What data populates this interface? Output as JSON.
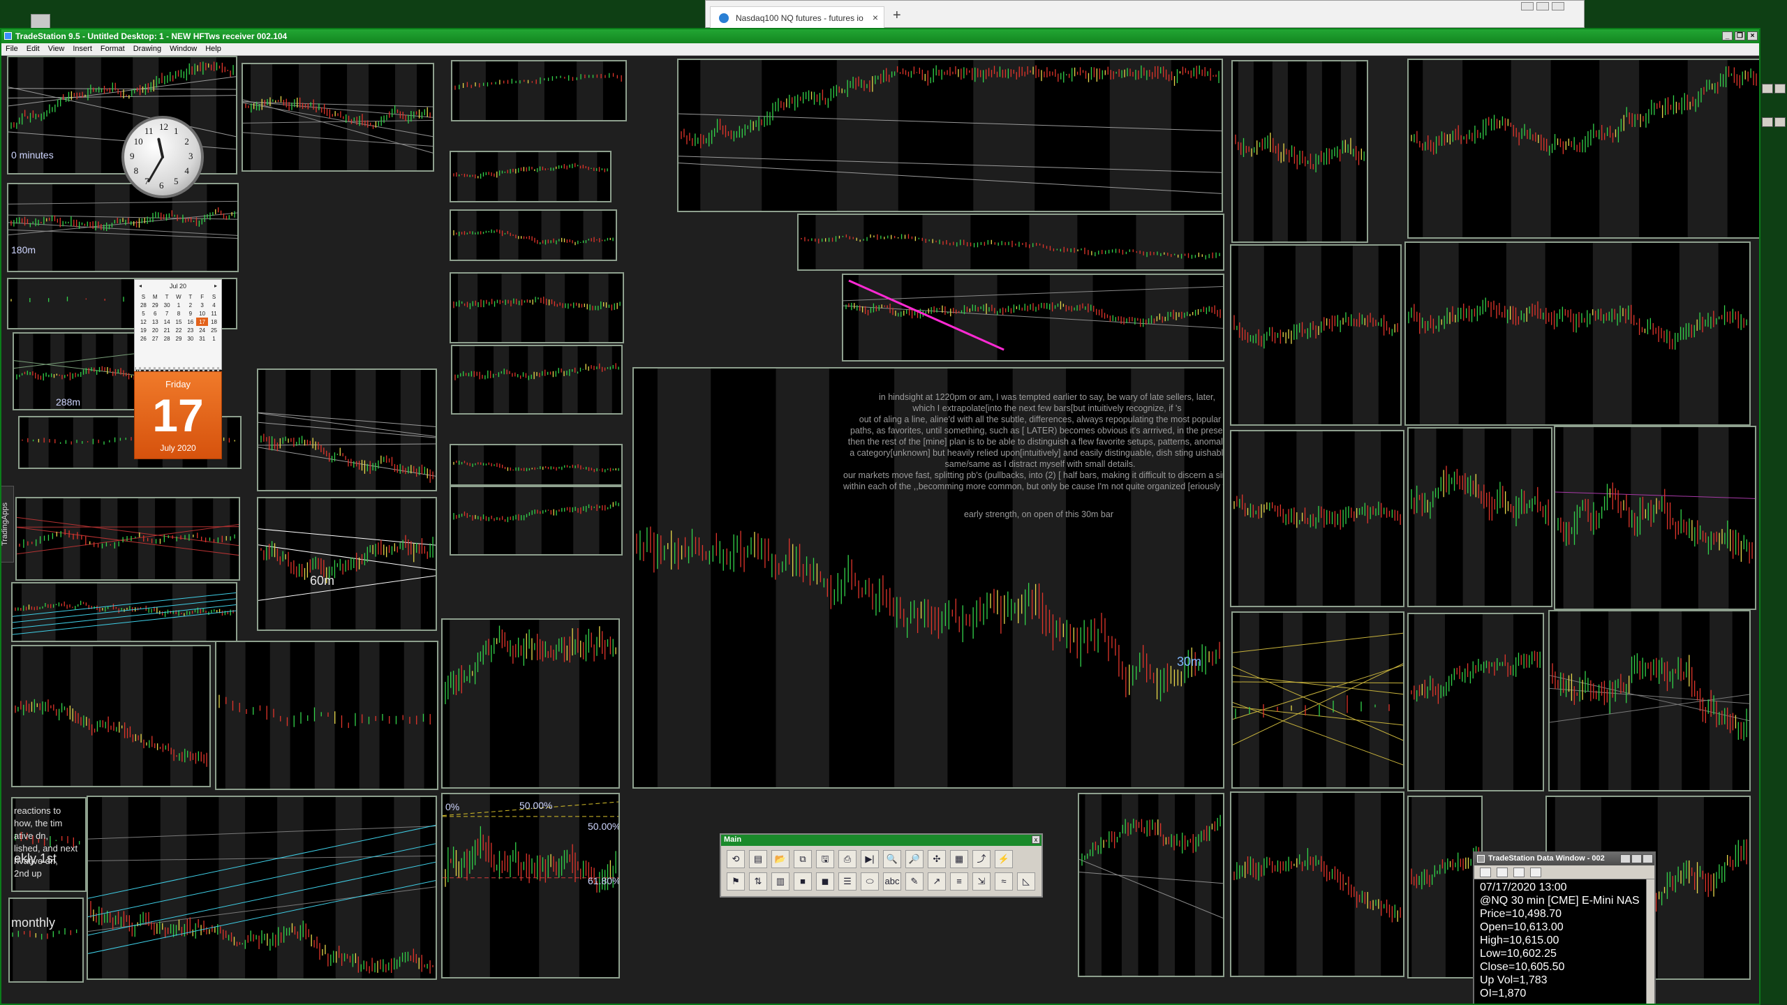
{
  "browser": {
    "tab_title": "Nasdaq100 NQ futures - futures io",
    "close_glyph": "×",
    "new_tab_glyph": "+"
  },
  "window": {
    "title": "TradeStation 9.5 - Untitled Desktop: 1 - NEW HFTws receiver 002.104",
    "menu": [
      "File",
      "Edit",
      "View",
      "Insert",
      "Format",
      "Drawing",
      "Window",
      "Help"
    ]
  },
  "side_tab": "TradingApps",
  "clock": {
    "numerals": [
      "12",
      "1",
      "2",
      "3",
      "4",
      "5",
      "6",
      "7",
      "8",
      "9",
      "10",
      "11"
    ],
    "hour": 11,
    "minute": 35
  },
  "calendar": {
    "month_label": "Jul 20",
    "prev": "◂",
    "next": "▸",
    "weekdays": [
      "S",
      "M",
      "T",
      "W",
      "T",
      "F",
      "S"
    ],
    "weeks": [
      [
        "28",
        "29",
        "30",
        "1",
        "2",
        "3",
        "4"
      ],
      [
        "5",
        "6",
        "7",
        "8",
        "9",
        "10",
        "11"
      ],
      [
        "12",
        "13",
        "14",
        "15",
        "16",
        "17",
        "18"
      ],
      [
        "19",
        "20",
        "21",
        "22",
        "23",
        "24",
        "25"
      ],
      [
        "26",
        "27",
        "28",
        "29",
        "30",
        "31",
        "1"
      ]
    ],
    "today": "17",
    "day_name": "Friday",
    "day_number": "17",
    "month_year": "July 2020"
  },
  "chart_labels": {
    "tl_minutes": "0 minutes",
    "c180": "180m",
    "c288": "288m",
    "c60": "60m",
    "c30": "30m",
    "monthly": "monthly",
    "weekly": "ekly 1st",
    "pct0": "0%",
    "pct50a": "50.00%",
    "pct50b": "50.00%",
    "pct61": "61.80%",
    "weekly_notes": [
      "reactions to",
      "how, the tim",
      "ative dn,",
      "lished, and next",
      "rivative dn,",
      "2nd up"
    ]
  },
  "annotations": [
    "in hindsight at 1220pm or am, I was tempted earlier to say, be wary of late sellers, later,",
    "which I extrapolate[into the next few bars[but intuitively recognize, if 's",
    "out of aling a line, aline'd with all the subtle, differences, always repopulating the most popular",
    "paths, as favorites, until something, such as [ LATER) becomes obvious it's arrrived, in the present",
    "then the rest of the [mine] plan is to be able to distinguish a flew favorite setups, patterns, anomalies, of",
    "a category[unknown] but heavily relied upon[intuitively] and easily distinguable, dish sting uishable,",
    "same/same as I distract myself with small details.",
    "our markets move fast, splitting pb's (pullbacks, into (2) [ half bars, making it difficult to discern a single pricebar",
    "within each of the ,,becomming more common, but only be cause I'm not quite organized [eriously funny, but tru",
    "early strength, on open of this 30m bar"
  ],
  "main_toolbar": {
    "title": "Main",
    "close": "x",
    "buttons": [
      "⟲",
      "▤",
      "📂",
      "⧉",
      "🖫",
      "⎙",
      "▶|",
      "🔍",
      "🔎",
      "✣",
      "▦",
      "⤴",
      "⚡",
      "⚑",
      "⇅",
      "▥",
      "■",
      "◼",
      "☰",
      "⬭",
      "abc",
      "✎",
      "↗",
      "≡",
      "⇲",
      "≈",
      "◺"
    ]
  },
  "data_window": {
    "title": "TradeStation Data Window - 002",
    "rows": [
      "07/17/2020 13:00",
      "@NQ 30 min [CME] E-Mini NAS",
      "Price=10,498.70",
      "Open=10,613.00",
      "High=10,615.00",
      "Low=10,602.25",
      "Close=10,605.50",
      "Up Vol=1,783",
      "OI=1,870"
    ]
  },
  "colors": {
    "frame_green": "#0b7d1a",
    "up_bar": "#33d24a",
    "down_bar": "#e0352b",
    "neutral_bar": "#e8d84a",
    "trend_magenta": "#ff2ad4",
    "fib_yellow": "#d8c12a",
    "trend_cyan": "#3fd0e8"
  }
}
